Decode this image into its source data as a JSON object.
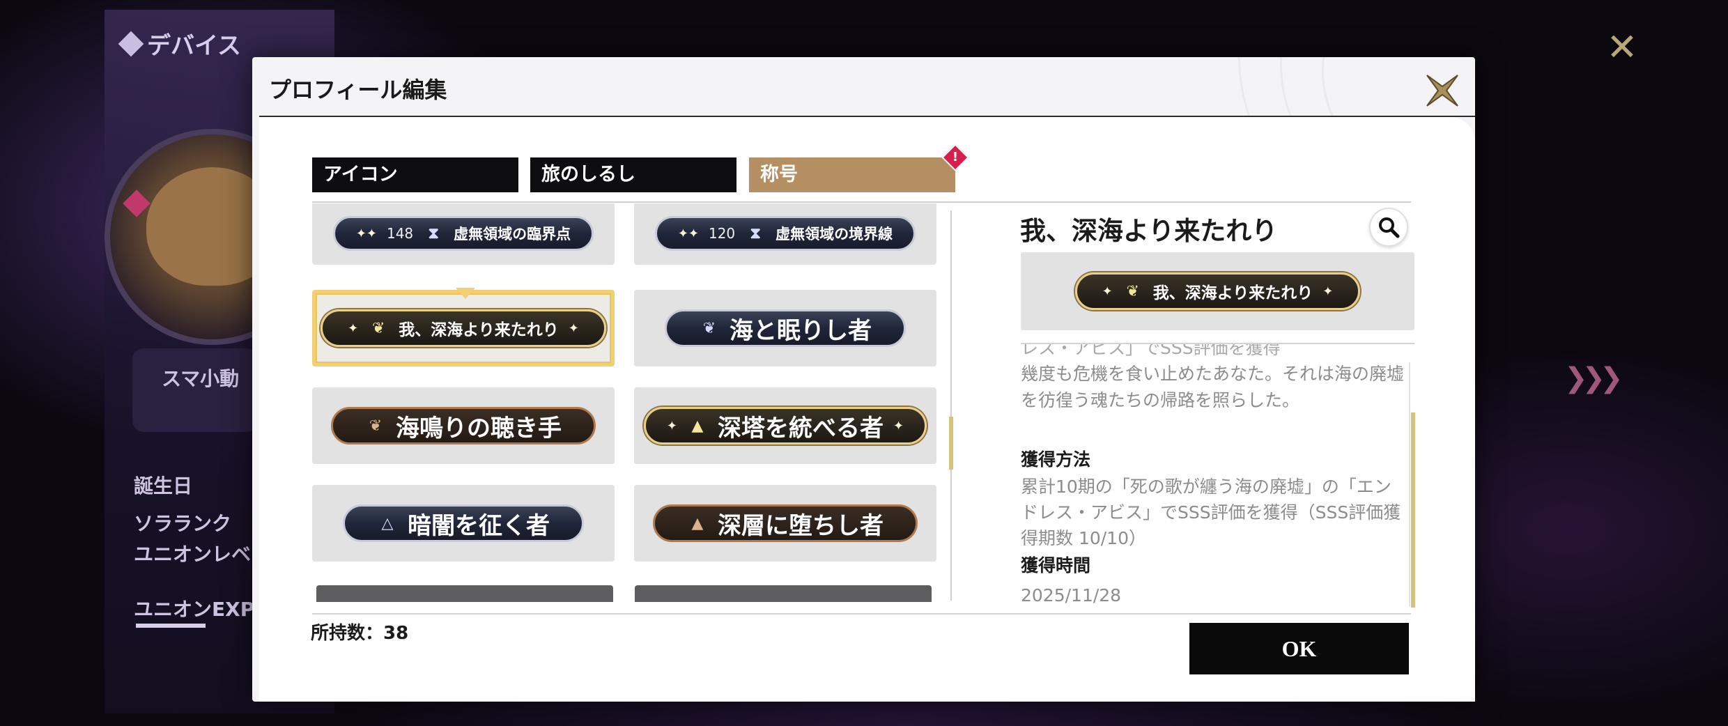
{
  "background": {
    "section_title": "デバイス",
    "labels": [
      "スマ小動",
      "誕生日",
      "ソラランク",
      "ユニオンレベ",
      "ユニオンEXP"
    ]
  },
  "modal": {
    "title": "プロフィール編集",
    "tabs": [
      {
        "label": "アイコン",
        "active": false
      },
      {
        "label": "旅のしるし",
        "active": false
      },
      {
        "label": "称号",
        "active": true,
        "badge": "!"
      }
    ],
    "titles": [
      {
        "number": "148",
        "label": "虚無領域の臨界点",
        "style": "navy",
        "icon": "hourglass-icon"
      },
      {
        "number": "120",
        "label": "虚無領域の境界線",
        "style": "navy",
        "icon": "hourglass-icon"
      },
      {
        "label": "我、深海より来たれり",
        "style": "gold",
        "icon": "dragon-icon",
        "selected": true
      },
      {
        "label": "海と眠りし者",
        "style": "navy",
        "icon": "dragon-icon"
      },
      {
        "label": "海鳴りの聴き手",
        "style": "bronze",
        "icon": "dragon-icon"
      },
      {
        "label": "深塔を統べる者",
        "style": "gold",
        "icon": "triangle-icon"
      },
      {
        "label": "暗闇を征く者",
        "style": "navy",
        "icon": "triangle-icon"
      },
      {
        "label": "深層に堕ちし者",
        "style": "bronze",
        "icon": "triangle-icon"
      }
    ],
    "detail": {
      "title": "我、深海より来たれり",
      "badge_label": "我、深海より来たれり",
      "cut_text": "レス・アビス」でSSS評価を獲得",
      "description": "幾度も危機を食い止めたあなた。それは海の廃墟を彷徨う魂たちの帰路を照らした。",
      "method_heading": "獲得方法",
      "method_text": "累計10期の「死の歌が纏う海の廃墟」の「エンドレス・アビス」でSSS評価を獲得（SSS評価獲得期数 10/10）",
      "time_heading": "獲得時間",
      "time_value": "2025/11/28"
    },
    "owned_count": "所持数：38",
    "ok_label": "OK"
  },
  "colors": {
    "accent_gold": "#d6c27a",
    "tab_active": "#b48f62",
    "badge_alert": "#d4204a"
  }
}
